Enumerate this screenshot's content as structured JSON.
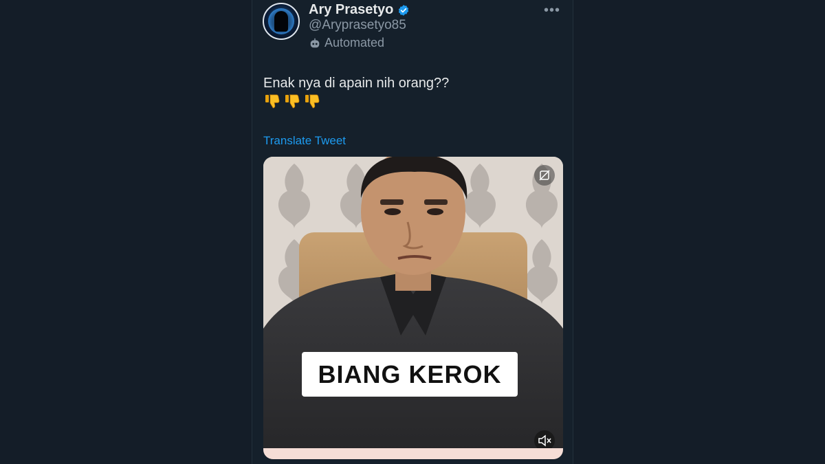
{
  "user": {
    "display_name": "Ary Prasetyo",
    "handle": "@Aryprasetyo85",
    "label": "Automated"
  },
  "tweet": {
    "text": "Enak nya di apain nih orang??",
    "emojis": [
      "thumbs-down",
      "thumbs-down",
      "thumbs-down"
    ],
    "translate_label": "Translate Tweet"
  },
  "media": {
    "caption": "BIANG KEROK"
  },
  "colors": {
    "background": "#141d28",
    "column": "#15202b",
    "text": "#e7e9ea",
    "muted": "#8b98a5",
    "link": "#1d9bf0"
  },
  "icons": [
    "verified-badge-icon",
    "bot-icon",
    "more-icon",
    "thumbs-down-icon",
    "gif-icon",
    "mute-icon"
  ]
}
